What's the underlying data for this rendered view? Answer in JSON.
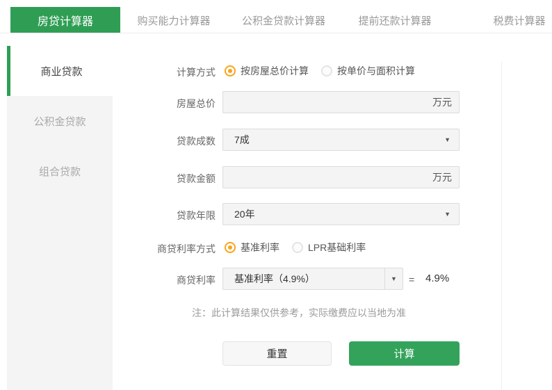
{
  "colors": {
    "accent_green": "#2f9e54",
    "radio_orange": "#f9a41b"
  },
  "tabs": [
    {
      "label": "房贷计算器",
      "active": true
    },
    {
      "label": "购买能力计算器",
      "active": false
    },
    {
      "label": "公积金贷款计算器",
      "active": false
    },
    {
      "label": "提前还款计算器",
      "active": false
    },
    {
      "label": "税费计算器",
      "active": false
    }
  ],
  "sidebar": {
    "items": [
      {
        "label": "商业贷款",
        "active": true
      },
      {
        "label": "公积金贷款",
        "active": false
      },
      {
        "label": "组合贷款",
        "active": false
      }
    ]
  },
  "form": {
    "calc_method": {
      "label": "计算方式",
      "options": [
        {
          "label": "按房屋总价计算",
          "selected": true
        },
        {
          "label": "按单价与面积计算",
          "selected": false
        }
      ]
    },
    "house_price": {
      "label": "房屋总价",
      "value": "",
      "placeholder": "",
      "unit": "万元"
    },
    "loan_ratio": {
      "label": "贷款成数",
      "value": "7成"
    },
    "loan_amount": {
      "label": "贷款金额",
      "value": "",
      "placeholder": "",
      "unit": "万元"
    },
    "loan_years": {
      "label": "贷款年限",
      "value": "20年"
    },
    "rate_method": {
      "label": "商贷利率方式",
      "options": [
        {
          "label": "基准利率",
          "selected": true
        },
        {
          "label": "LPR基础利率",
          "selected": false
        }
      ]
    },
    "rate": {
      "label": "商贷利率",
      "value": "基准利率（4.9%）",
      "equals_sign": "=",
      "result": "4.9%"
    },
    "note": "注：此计算结果仅供参考，实际缴费应以当地为准",
    "buttons": {
      "reset": "重置",
      "calculate": "计算"
    }
  },
  "icons": {
    "dropdown_arrow": "▼"
  }
}
